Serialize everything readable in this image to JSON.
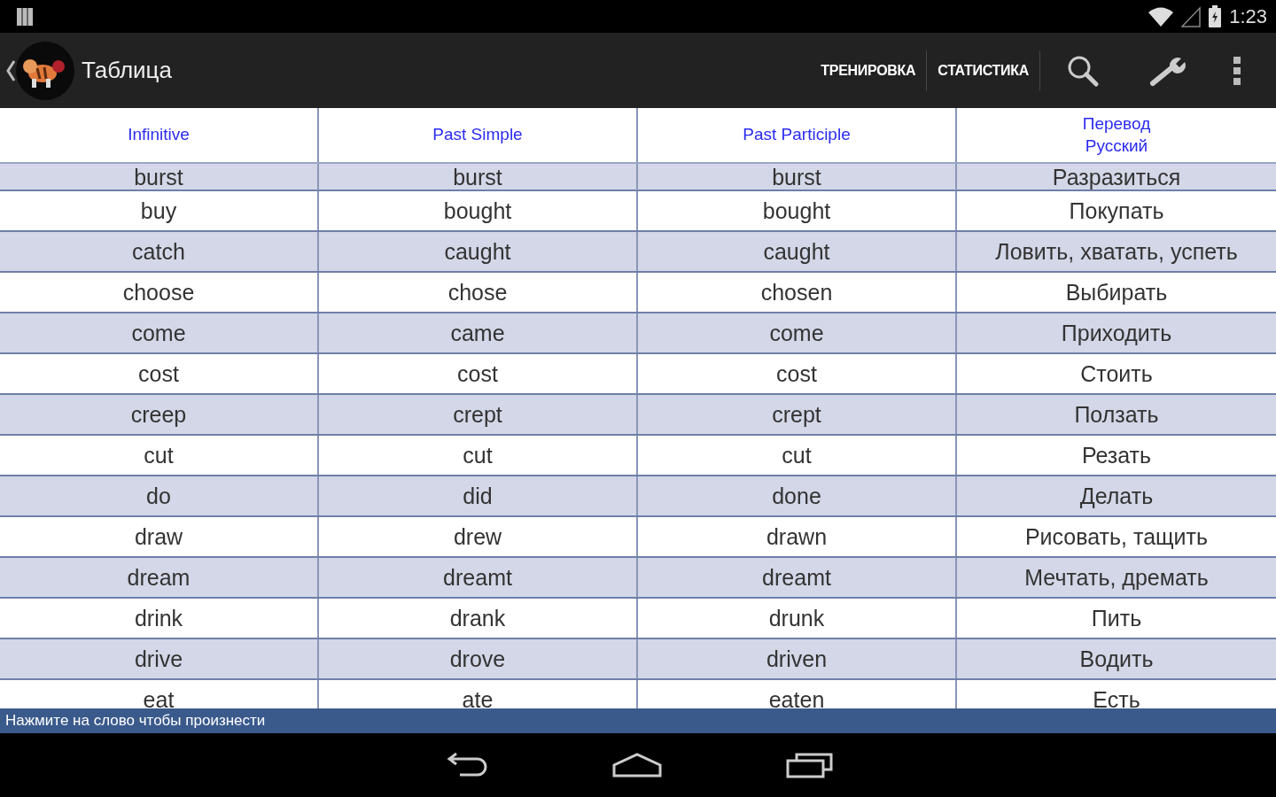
{
  "status_bar": {
    "time": "1:23"
  },
  "action_bar": {
    "title": "Таблица",
    "actions": [
      "ТРЕНИРОВКА",
      "СТАТИСТИКА"
    ]
  },
  "table": {
    "columns": [
      {
        "label": "Infinitive"
      },
      {
        "label": "Past Simple"
      },
      {
        "label": "Past Participle"
      },
      {
        "label": "Перевод\nРусский"
      }
    ],
    "rows": [
      [
        "burst",
        "burst",
        "burst",
        "Разразиться"
      ],
      [
        "buy",
        "bought",
        "bought",
        "Покупать"
      ],
      [
        "catch",
        "caught",
        "caught",
        "Ловить, хватать, успеть"
      ],
      [
        "choose",
        "chose",
        "chosen",
        "Выбирать"
      ],
      [
        "come",
        "came",
        "come",
        "Приходить"
      ],
      [
        "cost",
        "cost",
        "cost",
        "Стоить"
      ],
      [
        "creep",
        "crept",
        "crept",
        "Ползать"
      ],
      [
        "cut",
        "cut",
        "cut",
        "Резать"
      ],
      [
        "do",
        "did",
        "done",
        "Делать"
      ],
      [
        "draw",
        "drew",
        "drawn",
        "Рисовать, тащить"
      ],
      [
        "dream",
        "dreamt",
        "dreamt",
        "Мечтать, дремать"
      ],
      [
        "drink",
        "drank",
        "drunk",
        "Пить"
      ],
      [
        "drive",
        "drove",
        "driven",
        "Водить"
      ],
      [
        "eat",
        "ate",
        "eaten",
        "Есть"
      ]
    ]
  },
  "hint_bar": {
    "text": "Нажмите на слово чтобы произнести"
  }
}
